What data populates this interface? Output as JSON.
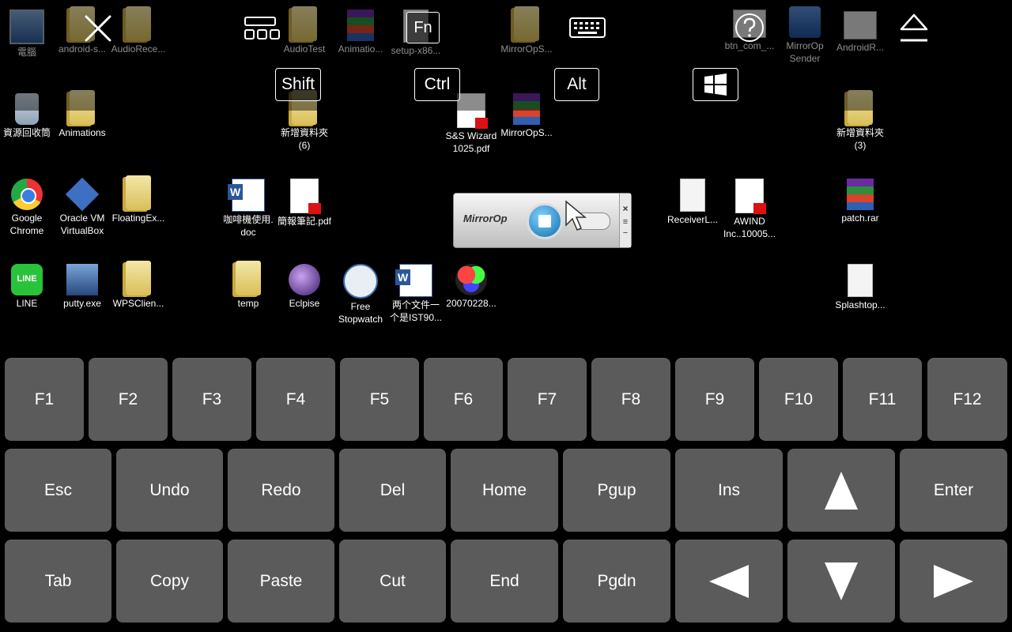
{
  "desktop": {
    "icons": [
      {
        "label": "電腦"
      },
      {
        "label": "android-s..."
      },
      {
        "label": "AudioRece..."
      },
      {
        "label": "AudioTest"
      },
      {
        "label": "Animatio..."
      },
      {
        "label": "setup-x86..."
      },
      {
        "label": "MirrorOpS..."
      },
      {
        "label": "btn_com_..."
      },
      {
        "label": "MirrorOp\nSender"
      },
      {
        "label": "AndroidR..."
      },
      {
        "label": "資源回收筒"
      },
      {
        "label": "Animations"
      },
      {
        "label": "新增資料夾\n(6)"
      },
      {
        "label": "S&S Wizard\n1025.pdf"
      },
      {
        "label": "MirrorOpS..."
      },
      {
        "label": "新增資料夾\n(3)"
      },
      {
        "label": "Google\nChrome"
      },
      {
        "label": "Oracle VM\nVirtualBox"
      },
      {
        "label": "FloatingEx..."
      },
      {
        "label": "咖啡機使用.\ndoc"
      },
      {
        "label": "簡報筆記.pdf"
      },
      {
        "label": "ReceiverL..."
      },
      {
        "label": "AWIND\nInc..10005..."
      },
      {
        "label": "patch.rar"
      },
      {
        "label": "LINE"
      },
      {
        "label": "putty.exe"
      },
      {
        "label": "WPSClien..."
      },
      {
        "label": "temp"
      },
      {
        "label": "Eclpise"
      },
      {
        "label": "Free\nStopwatch"
      },
      {
        "label": "两个文件一\n个是IST90..."
      },
      {
        "label": "20070228..."
      },
      {
        "label": "Splashtop..."
      }
    ]
  },
  "top_controls": {
    "fn_label": "Fn",
    "modifiers": [
      "Shift",
      "Ctrl",
      "Alt"
    ]
  },
  "mirrorop_widget": {
    "logo_text": "MirrorOp"
  },
  "keyboard": {
    "function_row": [
      "F1",
      "F2",
      "F3",
      "F4",
      "F5",
      "F6",
      "F7",
      "F8",
      "F9",
      "F10",
      "F11",
      "F12"
    ],
    "row2": [
      "Esc",
      "Undo",
      "Redo",
      "Del",
      "Home",
      "Pgup",
      "Ins",
      "Enter"
    ],
    "row3": [
      "Tab",
      "Copy",
      "Paste",
      "Cut",
      "End",
      "Pgdn"
    ]
  },
  "colors": {
    "key_bg": "#5b5b5b",
    "desktop_bg": "#000000"
  }
}
